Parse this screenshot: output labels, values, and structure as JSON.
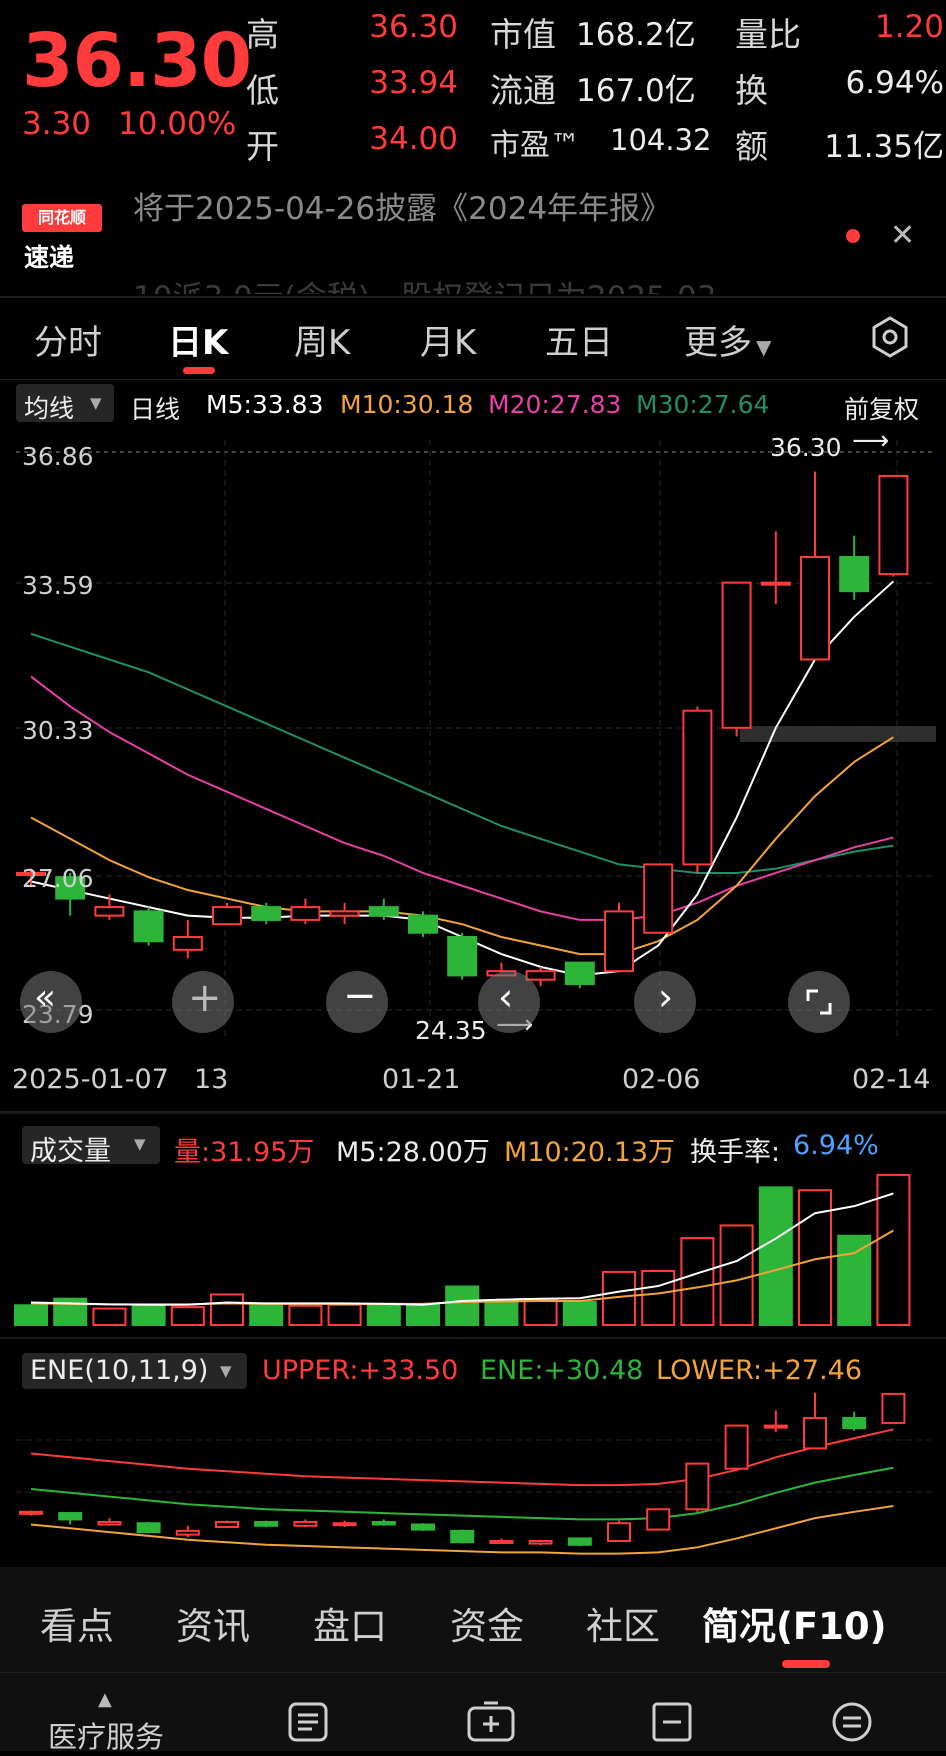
{
  "quote": {
    "price": "36.30",
    "change": "3.30",
    "change_pct": "10.00%",
    "high_label": "高",
    "high": "36.30",
    "low_label": "低",
    "low": "33.94",
    "open_label": "开",
    "open": "34.00",
    "mktcap_label": "市值",
    "mktcap": "168.2亿",
    "float_label": "流通",
    "float": "167.0亿",
    "pe_label": "市盈™",
    "pe": "104.32",
    "volratio_label": "量比",
    "volratio": "1.20",
    "turnover_label": "换",
    "turnover": "6.94%",
    "amount_label": "额",
    "amount": "11.35亿"
  },
  "notice": {
    "logo_top": "同花顺",
    "logo_bottom": "速递",
    "text": "将于2025-04-26披露《2024年年报》",
    "text2": "10派3.0元(含税)，股权登记日为2025-03"
  },
  "tabs": [
    "分时",
    "日K",
    "周K",
    "月K",
    "五日",
    "更多"
  ],
  "legend": {
    "selector": "均线",
    "period": "日线",
    "m5": "M5:33.83",
    "m10": "M10:30.18",
    "m20": "M20:27.83",
    "m30": "M30:27.64",
    "adjust": "前复权"
  },
  "kchart": {
    "y_labels": [
      "36.86",
      "33.59",
      "30.33",
      "27.06",
      "23.79"
    ],
    "high_marker": "36.30",
    "low_marker": "24.35",
    "dates": [
      "2025-01-07",
      "13",
      "01-21",
      "02-06",
      "02-14"
    ]
  },
  "chart_data": [
    {
      "type": "candlestick",
      "title": "日K",
      "ylim": [
        23.79,
        36.86
      ],
      "ma": {
        "M5": 33.83,
        "M10": 30.18,
        "M20": 27.83,
        "M30": 27.64
      },
      "series_colors": {
        "up": "#ff3b3b",
        "down": "#2db53a",
        "M5": "#ffffff",
        "M10": "#f2a33a",
        "M20": "#e83fa8",
        "M30": "#1f8f6a"
      },
      "candles": [
        {
          "o": 27.0,
          "c": 27.0,
          "h": 27.1,
          "l": 26.7
        },
        {
          "o": 26.9,
          "c": 26.4,
          "h": 27.0,
          "l": 26.0
        },
        {
          "o": 26.0,
          "c": 26.2,
          "h": 26.5,
          "l": 25.9
        },
        {
          "o": 26.1,
          "c": 25.4,
          "h": 26.2,
          "l": 25.3
        },
        {
          "o": 25.2,
          "c": 25.5,
          "h": 25.9,
          "l": 25.0
        },
        {
          "o": 25.8,
          "c": 26.2,
          "h": 26.3,
          "l": 25.8
        },
        {
          "o": 26.2,
          "c": 25.9,
          "h": 26.3,
          "l": 25.8
        },
        {
          "o": 25.9,
          "c": 26.2,
          "h": 26.4,
          "l": 25.8
        },
        {
          "o": 26.0,
          "c": 26.1,
          "h": 26.3,
          "l": 25.8
        },
        {
          "o": 26.2,
          "c": 26.0,
          "h": 26.4,
          "l": 25.9
        },
        {
          "o": 26.0,
          "c": 25.6,
          "h": 26.1,
          "l": 25.5
        },
        {
          "o": 25.5,
          "c": 24.6,
          "h": 25.6,
          "l": 24.5
        },
        {
          "o": 24.6,
          "c": 24.7,
          "h": 24.9,
          "l": 24.6
        },
        {
          "o": 24.5,
          "c": 24.7,
          "h": 24.8,
          "l": 24.35
        },
        {
          "o": 24.9,
          "c": 24.4,
          "h": 24.9,
          "l": 24.3
        },
        {
          "o": 24.7,
          "c": 26.1,
          "h": 26.3,
          "l": 24.7
        },
        {
          "o": 25.6,
          "c": 27.2,
          "h": 27.2,
          "l": 25.6
        },
        {
          "o": 27.2,
          "c": 30.8,
          "h": 30.9,
          "l": 27.0
        },
        {
          "o": 30.4,
          "c": 33.8,
          "h": 33.8,
          "l": 30.2
        },
        {
          "o": 33.8,
          "c": 33.8,
          "h": 35.0,
          "l": 33.3
        },
        {
          "o": 32.0,
          "c": 34.4,
          "h": 36.4,
          "l": 32.0
        },
        {
          "o": 34.4,
          "c": 33.6,
          "h": 34.9,
          "l": 33.4
        },
        {
          "o": 34.0,
          "c": 36.3,
          "h": 36.3,
          "l": 33.94
        }
      ],
      "ma_lines": {
        "M5": [
          26.8,
          26.6,
          26.4,
          26.2,
          26.0,
          25.95,
          25.95,
          26.0,
          26.0,
          26.0,
          25.9,
          25.5,
          25.1,
          24.8,
          24.6,
          24.7,
          25.3,
          26.5,
          28.3,
          30.4,
          32.0,
          33.0,
          33.83
        ],
        "M10": [
          28.3,
          27.8,
          27.3,
          26.9,
          26.6,
          26.4,
          26.2,
          26.1,
          26.1,
          26.1,
          26.0,
          25.8,
          25.5,
          25.3,
          25.1,
          25.1,
          25.4,
          25.9,
          26.7,
          27.8,
          28.8,
          29.6,
          30.18
        ],
        "M20": [
          31.6,
          30.9,
          30.3,
          29.8,
          29.3,
          28.9,
          28.5,
          28.1,
          27.7,
          27.4,
          27.0,
          26.7,
          26.4,
          26.1,
          25.9,
          25.9,
          26.0,
          26.3,
          26.7,
          27.0,
          27.3,
          27.6,
          27.83
        ],
        "M30": [
          32.6,
          32.3,
          32.0,
          31.7,
          31.3,
          30.9,
          30.5,
          30.1,
          29.7,
          29.3,
          28.9,
          28.5,
          28.1,
          27.8,
          27.5,
          27.2,
          27.1,
          27.0,
          27.0,
          27.1,
          27.3,
          27.5,
          27.64
        ]
      }
    },
    {
      "type": "bar",
      "title": "成交量",
      "series_colors": {
        "up": "#ff3b3b",
        "down": "#2db53a",
        "M5": "#ffffff",
        "M10": "#f2a33a"
      },
      "values": [
        4.2,
        5.6,
        3.5,
        4.3,
        3.8,
        6.5,
        4.2,
        4.1,
        4.3,
        4.5,
        4.4,
        8.2,
        5.3,
        5.5,
        4.9,
        11.3,
        11.5,
        18.5,
        21.2,
        29.3,
        28.7,
        19.0,
        31.95
      ],
      "directions": [
        "d",
        "d",
        "u",
        "d",
        "u",
        "u",
        "d",
        "u",
        "u",
        "d",
        "d",
        "d",
        "d",
        "u",
        "d",
        "u",
        "u",
        "u",
        "u",
        "d",
        "u",
        "d",
        "u"
      ],
      "ma": {
        "M5": [
          4.8,
          4.6,
          4.4,
          4.3,
          4.3,
          4.8,
          4.6,
          4.6,
          4.6,
          4.5,
          4.3,
          5.1,
          5.4,
          5.6,
          5.7,
          7.1,
          8.3,
          11.0,
          13.6,
          18.4,
          23.8,
          25.3,
          28.0
        ],
        "M10": [
          4.6,
          4.5,
          4.4,
          4.4,
          4.4,
          4.6,
          4.5,
          4.5,
          4.5,
          4.5,
          4.5,
          4.9,
          5.0,
          5.1,
          5.1,
          6.0,
          6.7,
          8.0,
          9.5,
          11.7,
          14.0,
          15.3,
          20.13
        ]
      },
      "labels": {
        "vol": "量:31.95万",
        "m5": "M5:28.00万",
        "m10": "M10:20.13万",
        "turn_label": "换手率:",
        "turn": "6.94%"
      }
    },
    {
      "type": "line",
      "title": "ENE(10,11,9)",
      "labels": {
        "upper": "UPPER:+33.50",
        "ene": "ENE:+30.48",
        "lower": "LOWER:+27.46"
      },
      "series": [
        {
          "name": "UPPER",
          "values": [
            31.6,
            31.3,
            31.0,
            30.7,
            30.4,
            30.2,
            30.0,
            29.8,
            29.7,
            29.6,
            29.5,
            29.4,
            29.3,
            29.2,
            29.1,
            29.1,
            29.2,
            29.6,
            30.3,
            31.3,
            32.1,
            32.8,
            33.5
          ]
        },
        {
          "name": "ENE",
          "values": [
            28.8,
            28.5,
            28.2,
            27.9,
            27.6,
            27.4,
            27.2,
            27.1,
            27.0,
            26.9,
            26.8,
            26.7,
            26.6,
            26.5,
            26.4,
            26.4,
            26.5,
            26.9,
            27.6,
            28.5,
            29.3,
            29.9,
            30.48
          ]
        },
        {
          "name": "LOWER",
          "values": [
            26.0,
            25.7,
            25.4,
            25.1,
            24.8,
            24.6,
            24.4,
            24.3,
            24.2,
            24.1,
            24.0,
            23.9,
            23.8,
            23.8,
            23.7,
            23.7,
            23.8,
            24.2,
            24.9,
            25.7,
            26.5,
            27.0,
            27.46
          ]
        }
      ]
    }
  ],
  "volume": {
    "selector": "成交量",
    "vol": "量:31.95万",
    "m5": "M5:28.00万",
    "m10": "M10:20.13万",
    "turn_label": "换手率:",
    "turn": "6.94%"
  },
  "ene": {
    "selector": "ENE(10,11,9)",
    "upper": "UPPER:+33.50",
    "ene": "ENE:+30.48",
    "lower": "LOWER:+27.46"
  },
  "bottom_tabs": [
    "看点",
    "资讯",
    "盘口",
    "资金",
    "社区",
    "简况(F10)"
  ],
  "bottom_bar": {
    "medical": "医疗服务"
  },
  "colors": {
    "up": "#ff3b3b",
    "down": "#2db53a",
    "m5": "#ffffff",
    "m10": "#f2a33a",
    "m20": "#e83fa8",
    "m30": "#1f8f6a",
    "turnover_blue": "#4aa3ff"
  }
}
